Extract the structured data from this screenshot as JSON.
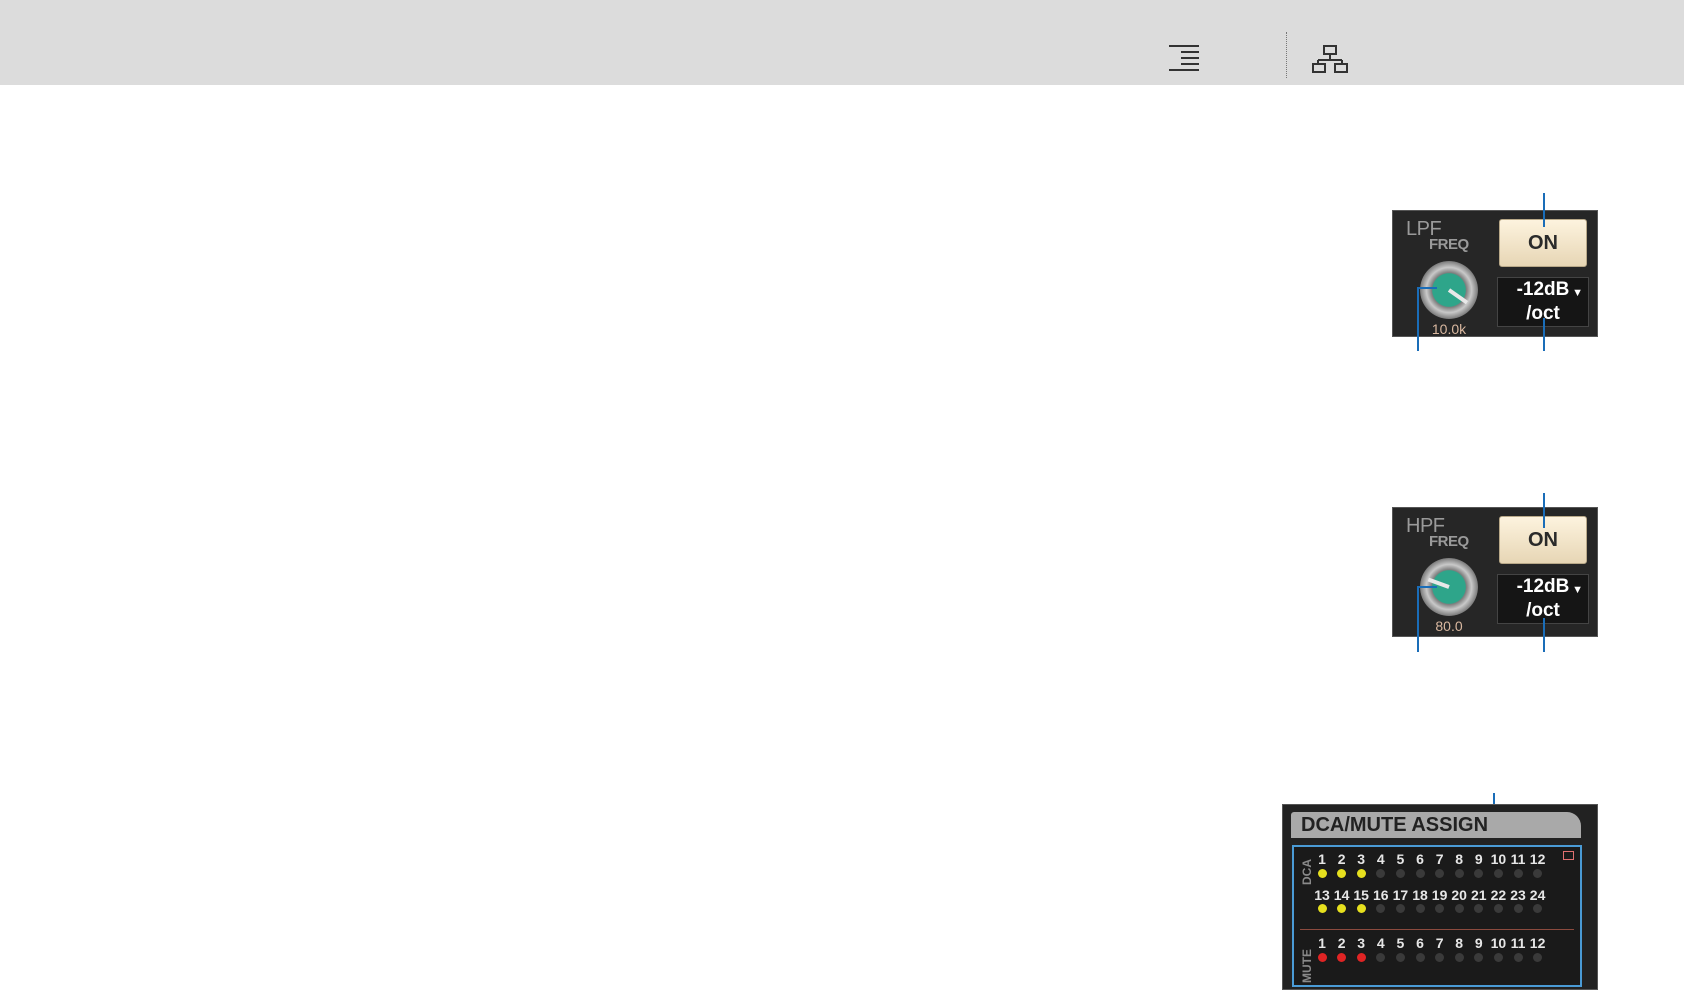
{
  "toolbar": {
    "icons": [
      "align-right-icon",
      "hierarchy-icon"
    ]
  },
  "lpf": {
    "title": "LPF",
    "freq_label": "FREQ",
    "freq_value": "10.0k",
    "on_label": "ON",
    "slope_line1": "-12dB",
    "slope_line2": "/oct"
  },
  "hpf": {
    "title": "HPF",
    "freq_label": "FREQ",
    "freq_value": "80.0",
    "on_label": "ON",
    "slope_line1": "-12dB",
    "slope_line2": "/oct"
  },
  "dca_mute": {
    "title": "DCA/MUTE ASSIGN",
    "dca_label": "DCA",
    "mute_label": "MUTE",
    "dca_numbers_row1": [
      "1",
      "2",
      "3",
      "4",
      "5",
      "6",
      "7",
      "8",
      "9",
      "10",
      "11",
      "12"
    ],
    "dca_numbers_row2": [
      "13",
      "14",
      "15",
      "16",
      "17",
      "18",
      "19",
      "20",
      "21",
      "22",
      "23",
      "24"
    ],
    "mute_numbers": [
      "1",
      "2",
      "3",
      "4",
      "5",
      "6",
      "7",
      "8",
      "9",
      "10",
      "11",
      "12"
    ],
    "dca_active_row1": [
      true,
      true,
      true,
      false,
      false,
      false,
      false,
      false,
      false,
      false,
      false,
      false
    ],
    "dca_active_row2": [
      true,
      true,
      true,
      false,
      false,
      false,
      false,
      false,
      false,
      false,
      false,
      false
    ],
    "mute_active": [
      true,
      true,
      true,
      false,
      false,
      false,
      false,
      false,
      false,
      false,
      false,
      false
    ],
    "colors": {
      "dca_on": "#e6e01e",
      "mute_on": "#e02424",
      "off": "#3a3a3a",
      "highlight": "#4a9bd6"
    }
  }
}
